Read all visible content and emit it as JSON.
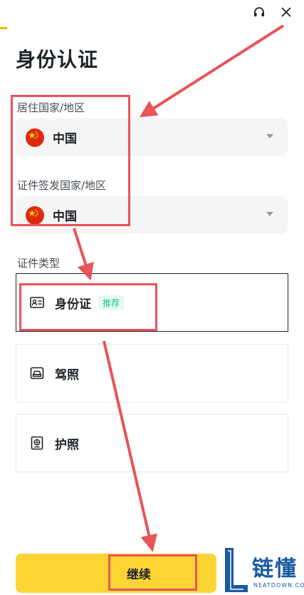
{
  "page": {
    "title": "身份认证"
  },
  "residence": {
    "label": "居住国家/地区",
    "value": "中国"
  },
  "issuing": {
    "label": "证件签发国家/地区",
    "value": "中国"
  },
  "doc_types": {
    "label": "证件类型",
    "items": [
      {
        "label": "身份证",
        "badge": "推荐"
      },
      {
        "label": "驾照"
      },
      {
        "label": "护照"
      }
    ]
  },
  "actions": {
    "continue_label": "继续"
  },
  "watermark": {
    "text": "链懂",
    "sub": "NEATDOWN.COM"
  },
  "colors": {
    "brand_yellow": "#fcd535",
    "annotation_red": "#e85458",
    "recommend_green": "#0ecb81"
  },
  "icons": {
    "support": "headset-icon",
    "close": "close-icon"
  }
}
